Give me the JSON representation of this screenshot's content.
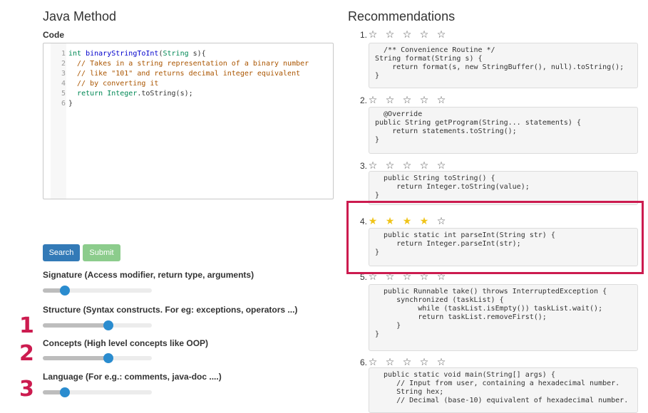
{
  "left": {
    "title": "Java Method",
    "code_label": "Code",
    "code_lines": [
      {
        "n": "1",
        "parts": [
          {
            "t": "int ",
            "c": "kw"
          },
          {
            "t": "binaryStringToInt",
            "c": "fn"
          },
          {
            "t": "(",
            "c": ""
          },
          {
            "t": "String",
            "c": "ty"
          },
          {
            "t": " s){",
            "c": ""
          }
        ]
      },
      {
        "n": "2",
        "parts": [
          {
            "t": "  // Takes in a string representation of a binary number",
            "c": "cm"
          }
        ]
      },
      {
        "n": "3",
        "parts": [
          {
            "t": "  // like \"101\" and returns decimal integer equivalent",
            "c": "cm"
          }
        ]
      },
      {
        "n": "4",
        "parts": [
          {
            "t": "  // by converting it",
            "c": "cm"
          }
        ]
      },
      {
        "n": "5",
        "parts": [
          {
            "t": "  ",
            "c": ""
          },
          {
            "t": "return ",
            "c": "kw"
          },
          {
            "t": "Integer",
            "c": "ty"
          },
          {
            "t": ".toString(s);",
            "c": ""
          }
        ]
      },
      {
        "n": "6",
        "parts": [
          {
            "t": "}",
            "c": ""
          }
        ]
      }
    ],
    "search_label": "Search",
    "submit_label": "Submit",
    "sliders": [
      {
        "label": "Signature (Access modifier, return type, arguments)",
        "value": 0.2
      },
      {
        "label": "Structure (Syntax constructs. For eg: exceptions, operators ...)",
        "value": 0.6
      },
      {
        "label": "Concepts (High level concepts like OOP)",
        "value": 0.6
      },
      {
        "label": "Language (For e.g.: comments, java-doc ....)",
        "value": 0.2
      }
    ],
    "annotations": [
      "1",
      "2",
      "3"
    ]
  },
  "right": {
    "title": "Recommendations",
    "star_glyph_on": "★",
    "star_glyph_off": "☆",
    "items": [
      {
        "num": "1.",
        "rating": 0,
        "code": "  /** Convenience Routine */\nString format(String s) {\n    return format(s, new StringBuffer(), null).toString();\n}"
      },
      {
        "num": "2.",
        "rating": 0,
        "code": "  @Override\npublic String getProgram(String... statements) {\n    return statements.toString();\n}"
      },
      {
        "num": "3.",
        "rating": 0,
        "code": "  public String toString() {\n     return Integer.toString(value);\n}"
      },
      {
        "num": "4.",
        "rating": 4,
        "code": "  public static int parseInt(String str) {\n     return Integer.parseInt(str);\n}"
      },
      {
        "num": "5.",
        "rating": 0,
        "code": "  public Runnable take() throws InterruptedException {\n     synchronized (taskList) {\n          while (taskList.isEmpty()) taskList.wait();\n          return taskList.removeFirst();\n     }\n}"
      },
      {
        "num": "6.",
        "rating": 0,
        "code": "  public static void main(String[] args) {\n     // Input from user, containing a hexadecimal number.\n     String hex;\n     // Decimal (base-10) equivalent of hexadecimal number."
      }
    ]
  },
  "colors": {
    "primary_button": "#337ab7",
    "submit_button": "#8ccc8c",
    "slider_thumb": "#2a8ccf",
    "highlight": "#cc1b4f",
    "star_on": "#f0c419"
  }
}
